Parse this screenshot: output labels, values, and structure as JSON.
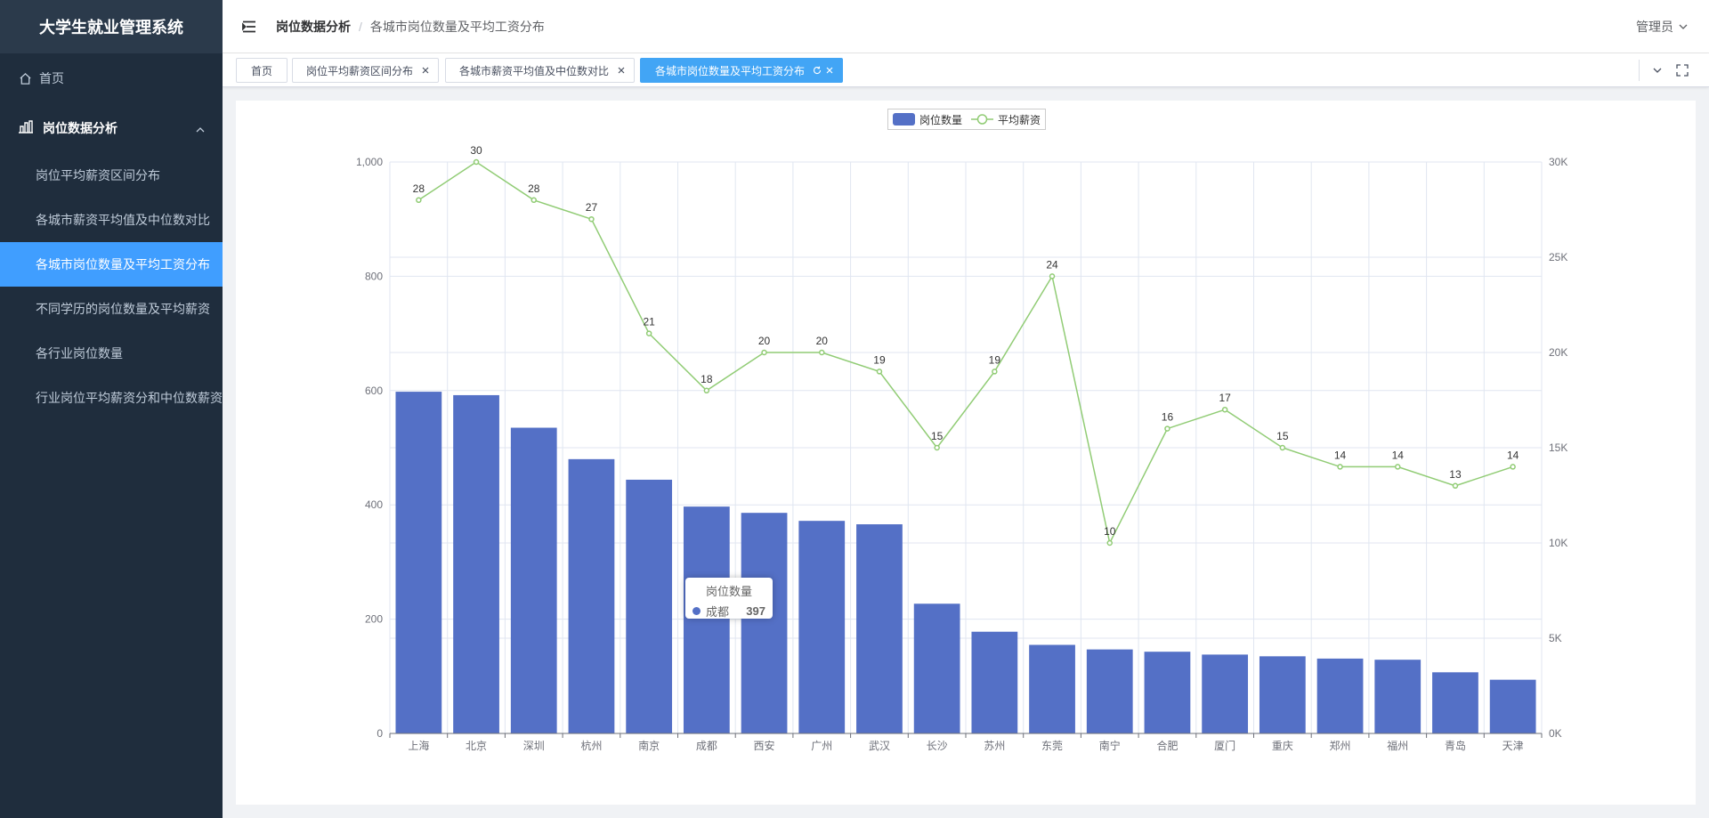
{
  "app": {
    "title": "大学生就业管理系统"
  },
  "sidebar": {
    "home_label": "首页",
    "group_label": "岗位数据分析",
    "items": [
      {
        "label": "岗位平均薪资区间分布"
      },
      {
        "label": "各城市薪资平均值及中位数对比"
      },
      {
        "label": "各城市岗位数量及平均工资分布",
        "active": true
      },
      {
        "label": "不同学历的岗位数量及平均薪资"
      },
      {
        "label": "各行业岗位数量"
      },
      {
        "label": "行业岗位平均薪资分和中位数薪资"
      }
    ]
  },
  "header": {
    "breadcrumb": [
      "岗位数据分析",
      "各城市岗位数量及平均工资分布"
    ],
    "user_label": "管理员"
  },
  "tags": [
    {
      "label": "首页"
    },
    {
      "label": "岗位平均薪资区间分布"
    },
    {
      "label": "各城市薪资平均值及中位数对比"
    },
    {
      "label": "各城市岗位数量及平均工资分布",
      "active": true
    }
  ],
  "colors": {
    "bar": "#5470c6",
    "line": "#91cc75",
    "active": "#409eff"
  },
  "chart_data": {
    "type": "bar",
    "categories": [
      "上海",
      "北京",
      "深圳",
      "杭州",
      "南京",
      "成都",
      "西安",
      "广州",
      "武汉",
      "长沙",
      "苏州",
      "东莞",
      "南宁",
      "合肥",
      "厦门",
      "重庆",
      "郑州",
      "福州",
      "青岛",
      "天津"
    ],
    "series": [
      {
        "name": "岗位数量",
        "type": "bar",
        "axis": "left",
        "values": [
          598,
          592,
          535,
          480,
          444,
          397,
          386,
          372,
          366,
          227,
          178,
          155,
          147,
          143,
          138,
          135,
          131,
          129,
          107,
          94
        ]
      },
      {
        "name": "平均薪资",
        "type": "line",
        "axis": "right",
        "values": [
          28,
          30,
          28,
          27,
          21,
          18,
          20,
          20,
          19,
          15,
          19,
          24,
          10,
          16,
          17,
          15,
          14,
          14,
          13,
          14
        ]
      }
    ],
    "y_left": {
      "min": 0,
      "max": 1000,
      "ticks": [
        "0",
        "200",
        "400",
        "600",
        "800",
        "1,000"
      ]
    },
    "y_right": {
      "min": 0,
      "max": 30,
      "ticks": [
        "0K",
        "5K",
        "10K",
        "15K",
        "20K",
        "25K",
        "30K"
      ]
    },
    "grid": true,
    "legend": "top-center",
    "tooltip": {
      "title": "岗位数量",
      "category": "成都",
      "value": "397"
    }
  }
}
